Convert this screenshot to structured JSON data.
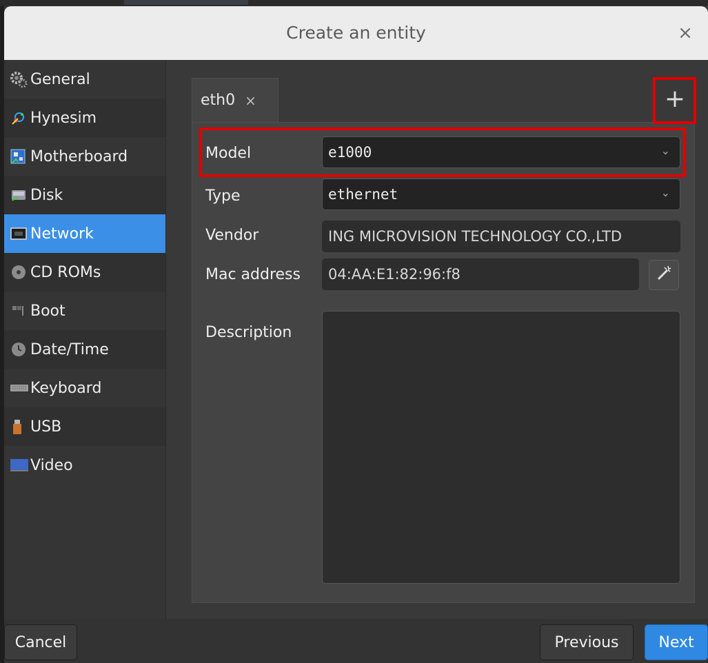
{
  "dialog": {
    "title": "Create an entity",
    "close_label": "×"
  },
  "sidebar": {
    "items": [
      {
        "label": "General",
        "icon": "gears-icon",
        "active": false
      },
      {
        "label": "Hynesim",
        "icon": "hynesim-icon",
        "active": false
      },
      {
        "label": "Motherboard",
        "icon": "motherboard-icon",
        "active": false
      },
      {
        "label": "Disk",
        "icon": "disk-icon",
        "active": false
      },
      {
        "label": "Network",
        "icon": "network-card-icon",
        "active": true
      },
      {
        "label": "CD ROMs",
        "icon": "cdrom-icon",
        "active": false
      },
      {
        "label": "Boot",
        "icon": "boot-icon",
        "active": false
      },
      {
        "label": "Date/Time",
        "icon": "clock-icon",
        "active": false
      },
      {
        "label": "Keyboard",
        "icon": "keyboard-icon",
        "active": false
      },
      {
        "label": "USB",
        "icon": "usb-icon",
        "active": false
      },
      {
        "label": "Video",
        "icon": "monitor-icon",
        "active": false
      }
    ],
    "active_color": "#3b8fe6"
  },
  "network": {
    "tabs": [
      {
        "label": "eth0",
        "close_label": "×"
      }
    ],
    "add_tab_label": "+",
    "form": {
      "model_label": "Model",
      "model_value": "e1000",
      "type_label": "Type",
      "type_value": "ethernet",
      "vendor_label": "Vendor",
      "vendor_value": "ING MICROVISION TECHNOLOGY CO.,LTD",
      "mac_label": "Mac address",
      "mac_value": "04:AA:E1:82:96:f8",
      "description_label": "Description",
      "description_value": ""
    }
  },
  "footer": {
    "cancel_label": "Cancel",
    "previous_label": "Previous",
    "next_label": "Next"
  },
  "highlight_color": "#e00000"
}
